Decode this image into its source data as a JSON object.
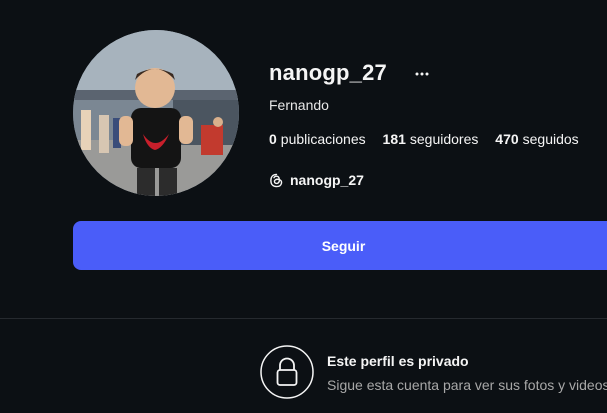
{
  "profile": {
    "username": "nanogp_27",
    "full_name": "Fernando",
    "more_icon": "ellipsis-icon",
    "avatar_alt": "profile-photo"
  },
  "stats": {
    "posts_count": "0",
    "posts_label": "publicaciones",
    "followers_count": "181",
    "followers_label": "seguidores",
    "following_count": "470",
    "following_label": "seguidos"
  },
  "threads": {
    "icon": "threads-icon",
    "handle": "nanogp_27"
  },
  "follow_button": {
    "label": "Seguir",
    "color": "#4a5df9"
  },
  "private_notice": {
    "icon": "lock-icon",
    "title": "Este perfil es privado",
    "subtitle": "Sigue esta cuenta para ver sus fotos y videos."
  },
  "colors": {
    "background": "#0c1014",
    "text": "#f5f5f5",
    "muted": "#a8a8a8"
  }
}
